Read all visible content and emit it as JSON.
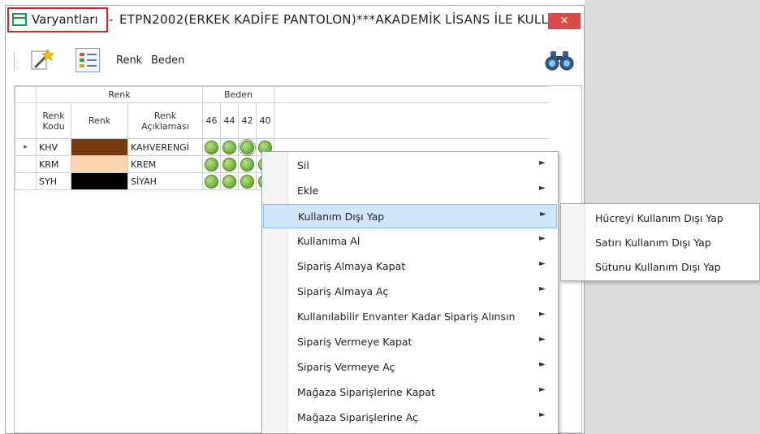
{
  "window": {
    "app_title": "Varyantları",
    "separator": "-",
    "doc_title": "ETPN2002(ERKEK KADİFE PANTOLON)***AKADEMİK LİSANS İLE KULL...",
    "close_label": "×"
  },
  "toolbar": {
    "renk_label": "Renk",
    "beden_label": "Beden",
    "icons": [
      "wand-icon",
      "list-icon",
      "binoculars-icon"
    ]
  },
  "grid": {
    "group_headers": {
      "renk": "Renk",
      "beden": "Beden"
    },
    "columns": {
      "renk_kodu": "Renk Kodu",
      "renk": "Renk",
      "renk_aciklamasi": "Renk Açıklaması",
      "sizes": [
        "46",
        "44",
        "42",
        "40"
      ]
    },
    "rows": [
      {
        "indicator": "▸",
        "code": "KHV",
        "color": "#7a3a10",
        "desc": "KAHVERENGİ"
      },
      {
        "indicator": "",
        "code": "KRM",
        "color": "#fbd5b0",
        "desc": "KREM"
      },
      {
        "indicator": "",
        "code": "SYH",
        "color": "#000000",
        "desc": "SİYAH"
      }
    ],
    "dot_color": "#6aae35"
  },
  "context_menu": {
    "items": [
      {
        "label": "Sil",
        "arrow": "►"
      },
      {
        "label": "Ekle",
        "arrow": "►"
      },
      {
        "label": "Kullanım Dışı Yap",
        "arrow": "►"
      },
      {
        "label": "Kullanıma Al",
        "arrow": "►"
      },
      {
        "label": "Sipariş Almaya Kapat",
        "arrow": "►"
      },
      {
        "label": "Sipariş Almaya Aç",
        "arrow": "►"
      },
      {
        "label": "Kullanılabilir Envanter Kadar Sipariş Alınsın",
        "arrow": "►"
      },
      {
        "label": "Sipariş Vermeye Kapat",
        "arrow": "►"
      },
      {
        "label": "Sipariş Vermeye Aç",
        "arrow": "►"
      },
      {
        "label": "Mağaza Siparişlerine Kapat",
        "arrow": "►"
      },
      {
        "label": "Mağaza Siparişlerine Aç",
        "arrow": "►"
      }
    ],
    "highlighted_index": 2,
    "highlight_color": "#cfe6fb"
  },
  "submenu": {
    "items": [
      "Hücreyi Kullanım Dışı Yap",
      "Satırı Kullanım Dışı Yap",
      "Sütunu Kullanım Dışı Yap"
    ]
  },
  "colors": {
    "title_highlight_border": "#d7261e",
    "close_button": "#d84b4b"
  }
}
